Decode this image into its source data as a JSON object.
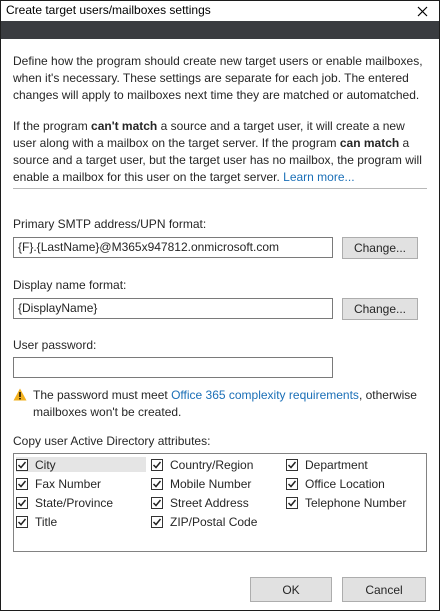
{
  "window": {
    "title": "Create target users/mailboxes settings"
  },
  "intro": {
    "p1": "Define how the program should create new target users or enable mailboxes, when it's necessary. These settings are separate for each job. The entered changes will apply to mailboxes next time they are matched or automatched.",
    "p2_a": "If the program ",
    "p2_b": "can't match",
    "p2_c": " a source and a target user, it will create a new user along with a mailbox on the target server. If the program ",
    "p2_d": "can match",
    "p2_e": " a source and a target user, but the target user has no mailbox, the program will enable a mailbox for this user on the target server. ",
    "learn_more": "Learn more..."
  },
  "smtp": {
    "label": "Primary SMTP address/UPN format:",
    "value": "{F}.{LastName}@M365x947812.onmicrosoft.com",
    "change_label": "Change..."
  },
  "display_name": {
    "label": "Display name format:",
    "value": "{DisplayName}",
    "change_label": "Change..."
  },
  "password": {
    "label": "User password:",
    "value": ""
  },
  "warning": {
    "text_a": "The password must meet ",
    "link": "Office 365 complexity requirements",
    "text_b": ", otherwise mailboxes won't be created."
  },
  "attributes": {
    "label": "Copy user Active Directory attributes:",
    "items": [
      {
        "label": "City",
        "checked": true
      },
      {
        "label": "Country/Region",
        "checked": true
      },
      {
        "label": "Department",
        "checked": true
      },
      {
        "label": "Fax Number",
        "checked": true
      },
      {
        "label": "Mobile Number",
        "checked": true
      },
      {
        "label": "Office Location",
        "checked": true
      },
      {
        "label": "State/Province",
        "checked": true
      },
      {
        "label": "Street Address",
        "checked": true
      },
      {
        "label": "Telephone Number",
        "checked": true
      },
      {
        "label": "Title",
        "checked": true
      },
      {
        "label": "ZIP/Postal Code",
        "checked": true
      }
    ]
  },
  "footer": {
    "ok_label": "OK",
    "cancel_label": "Cancel"
  },
  "colors": {
    "link": "#1a6fb7",
    "header_band": "#3a3c40",
    "warning": "#f2b01e"
  },
  "icons": {
    "close": "close-icon",
    "warning": "warning-icon",
    "checkbox": "checkmark-icon"
  }
}
